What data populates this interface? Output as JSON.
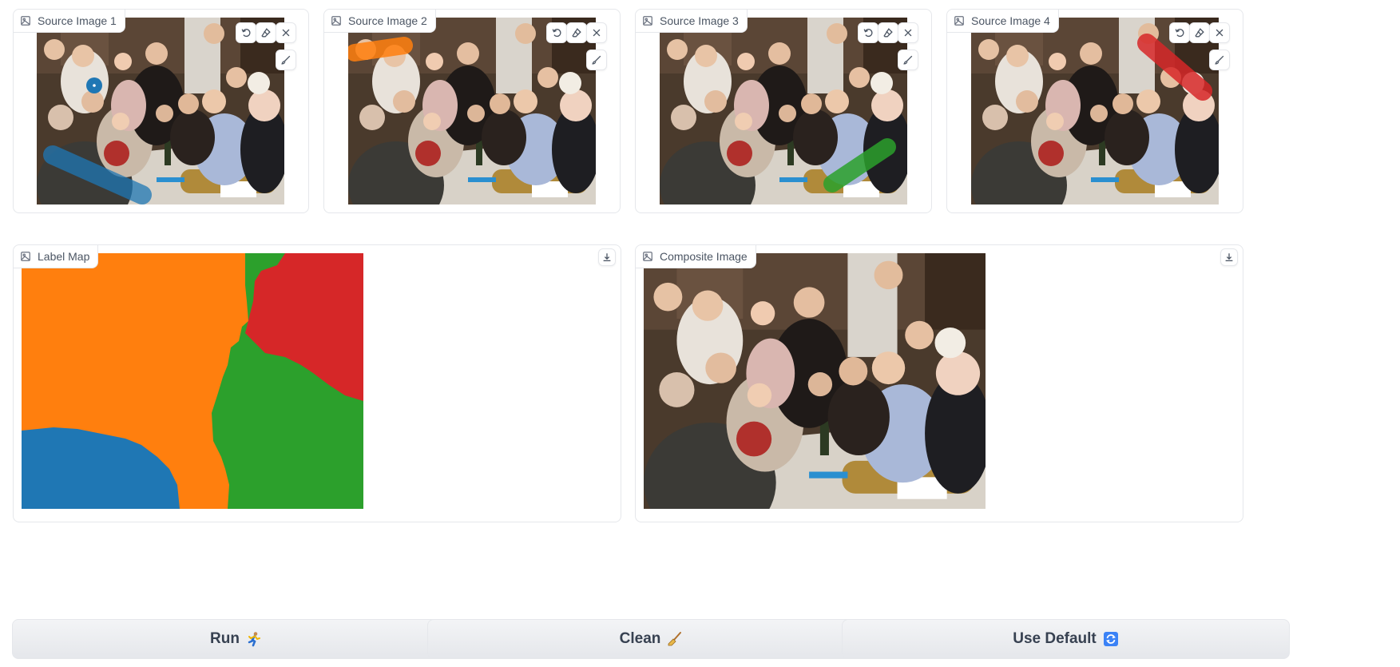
{
  "sources": [
    {
      "label": "Source Image 1",
      "stroke_color": "#1f77b4"
    },
    {
      "label": "Source Image 2",
      "stroke_color": "#ff7f0e"
    },
    {
      "label": "Source Image 3",
      "stroke_color": "#2ca02c"
    },
    {
      "label": "Source Image 4",
      "stroke_color": "#d62728"
    }
  ],
  "label_map": {
    "label": "Label Map"
  },
  "composite": {
    "label": "Composite Image"
  },
  "buttons": {
    "run": "Run",
    "clean": "Clean",
    "use_default": "Use Default"
  },
  "icons": {
    "image": "image-icon",
    "undo": "undo-icon",
    "eraser": "eraser-icon",
    "close": "close-icon",
    "brush": "brush-icon",
    "download": "download-icon",
    "run": "runner-emoji-icon",
    "clean": "broom-emoji-icon",
    "default": "refresh-emoji-icon"
  },
  "colors": {
    "blue": "#1f77b4",
    "orange": "#ff7f0e",
    "green": "#2ca02c",
    "red": "#d62728"
  }
}
